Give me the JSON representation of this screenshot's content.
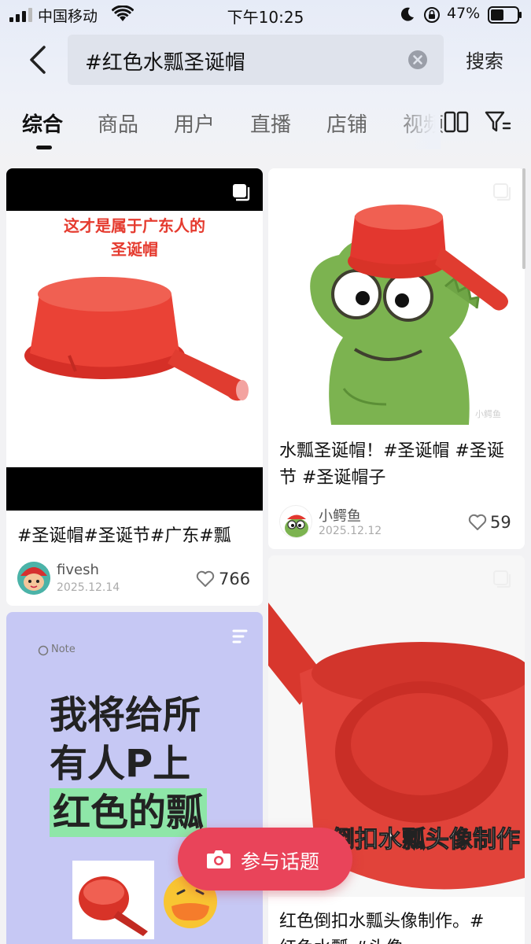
{
  "status_bar": {
    "carrier": "中国移动",
    "time": "下午10:25",
    "battery": "47%"
  },
  "search": {
    "query": "#红色水瓢圣诞帽",
    "button": "搜索"
  },
  "tabs": [
    "综合",
    "商品",
    "用户",
    "直播",
    "店铺",
    "视频"
  ],
  "cards": [
    {
      "image_caption": "这才是属于广东人的\n圣诞帽",
      "title": "#圣诞帽#圣诞节#广东#瓢",
      "author": "fivesh",
      "date": "2025.12.14",
      "likes": "766"
    },
    {
      "image_watermark": "小鳄鱼",
      "title": "水瓢圣诞帽！#圣诞帽 #圣诞节 #圣诞帽子",
      "author": "小鳄鱼",
      "date": "2025.12.12",
      "likes": "59"
    },
    {
      "note_tag": "Note",
      "image_text_lines": [
        "我将给所",
        "有人P上",
        "红色的瓢"
      ]
    },
    {
      "image_text": "倒扣水瓢头像制作",
      "title": "红色倒扣水瓢头像制作。#",
      "title_line2": "红色水瓢 #头像"
    }
  ],
  "join_button": "参与话题",
  "colors": {
    "accent": "#e9445a",
    "ladle_red": "#e3372f",
    "frog_green": "#7cb350"
  }
}
